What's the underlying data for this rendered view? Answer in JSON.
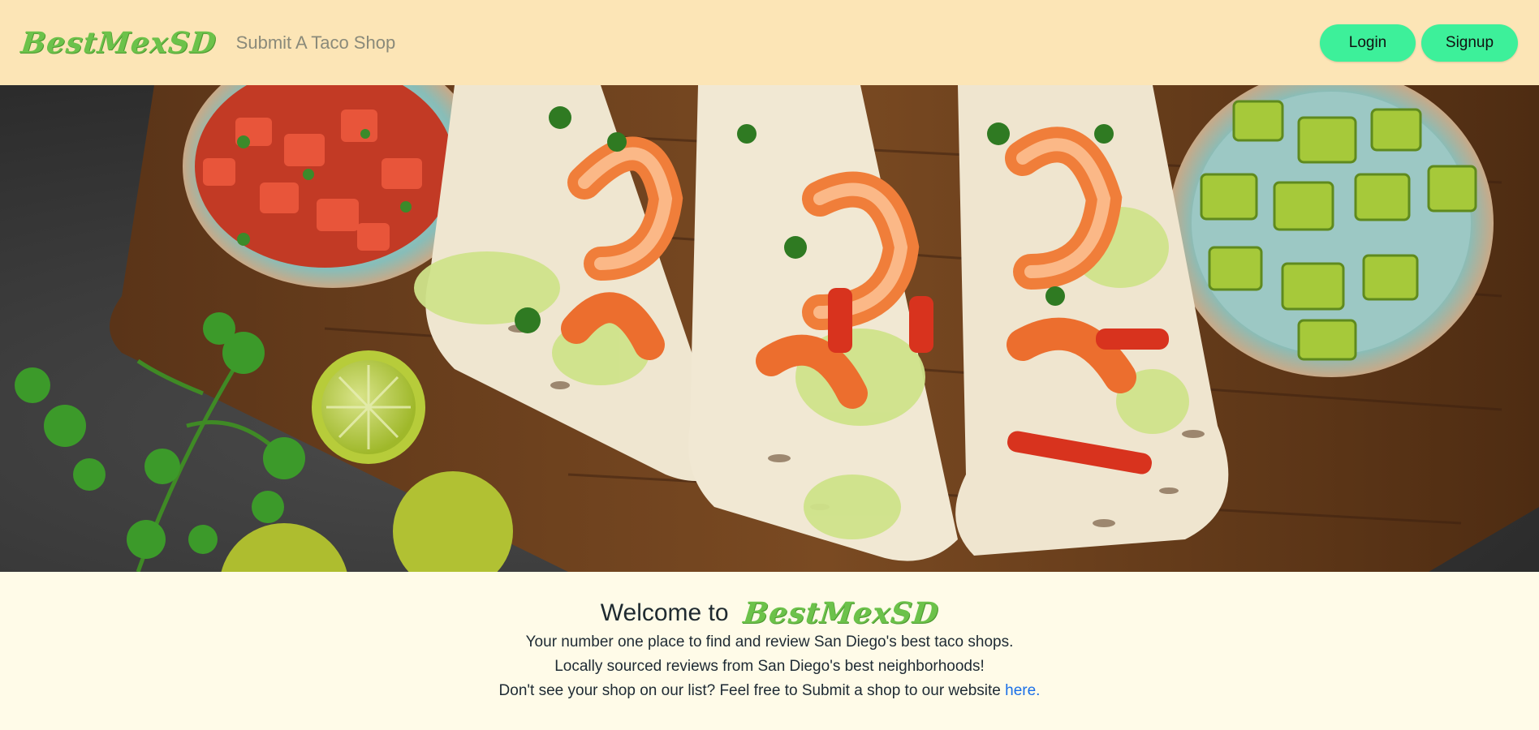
{
  "navbar": {
    "brand": "BestMexSD",
    "submit_link": "Submit A Taco Shop",
    "login_label": "Login",
    "signup_label": "Signup"
  },
  "hero": {
    "image_subject": "shrimp-tacos-with-salsa-avocado-lime-cilantro"
  },
  "welcome": {
    "title_prefix": "Welcome to",
    "brand": "BestMexSD",
    "line1": "Your number one place to find and review San Diego's best taco shops.",
    "line2": "Locally sourced reviews from San Diego's best neighborhoods!",
    "line3_prefix": "Don't see your shop on our list? Feel free to Submit a shop to our website ",
    "line3_link": "here."
  },
  "colors": {
    "navbar_bg": "#fce5b6",
    "page_bg": "#fffbe8",
    "brand_green": "#6cc24a",
    "button_green": "#3df09a",
    "link_blue": "#1a6fe8"
  }
}
